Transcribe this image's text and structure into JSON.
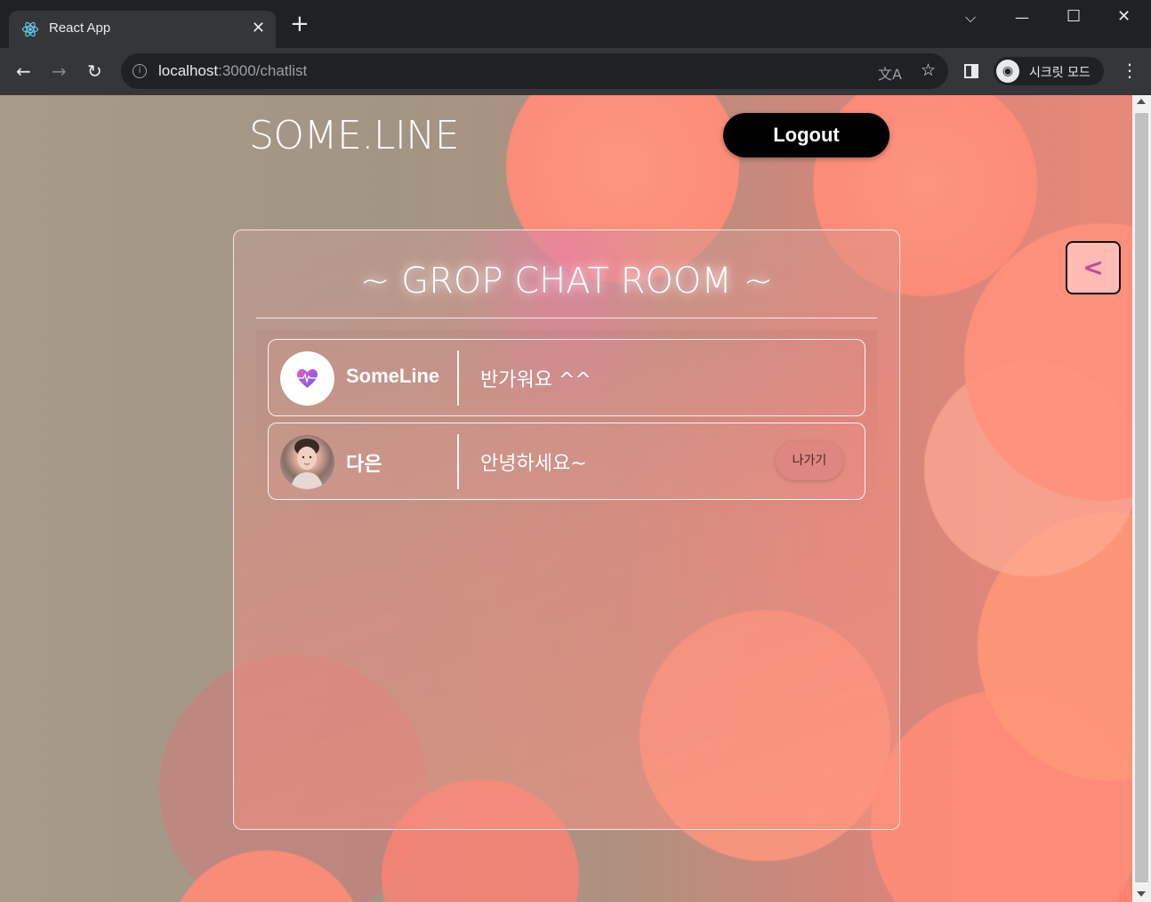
{
  "browser": {
    "tab_title": "React App",
    "tab_close_icon": "close-icon",
    "new_tab_icon": "plus-icon",
    "url_host": "localhost",
    "url_path": ":3000/chatlist",
    "incognito_label": "시크릿 모드"
  },
  "header": {
    "brand": "SOME.LINE",
    "logout_label": "Logout"
  },
  "panel": {
    "title": "~ GROP CHAT ROOM ~",
    "chats": [
      {
        "name": "SomeLine",
        "message": "반가워요 ^^",
        "avatar": "heart-logo-icon"
      },
      {
        "name": "다은",
        "message": "안녕하세요~",
        "avatar": "profile-photo",
        "leave_label": "나가기"
      }
    ]
  },
  "side_toggle_label": "<",
  "colors": {
    "logout_bg": "#000000",
    "side_toggle_text": "#c04a9a",
    "accent_pink": "#e06ad0"
  }
}
